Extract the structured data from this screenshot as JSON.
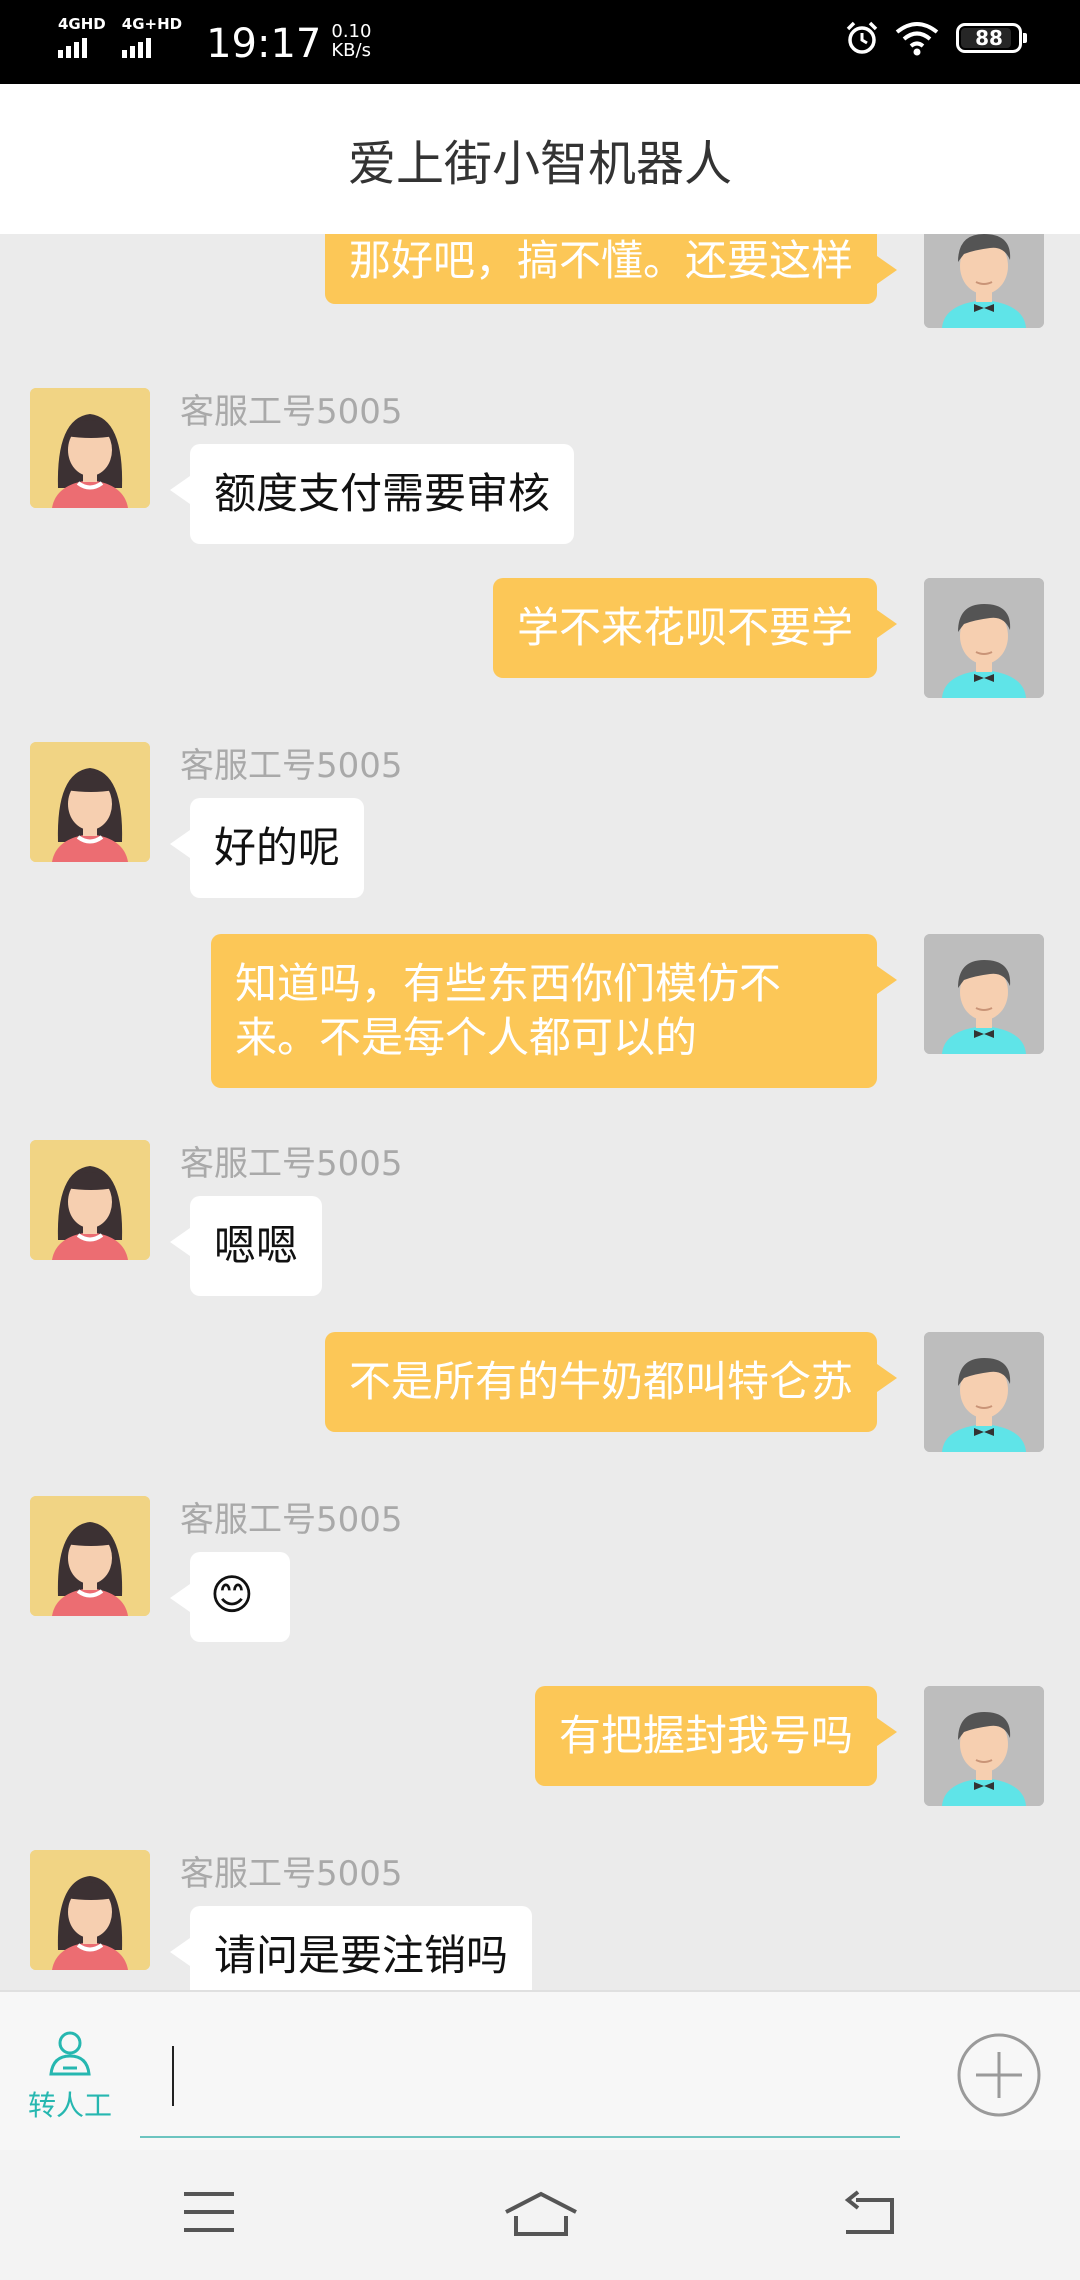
{
  "status": {
    "net1": "4GHD",
    "net2": "4G+HD",
    "time": "19:17",
    "speed_value": "0.10",
    "speed_unit": "KB/s",
    "battery": "88"
  },
  "header": {
    "title": "爱上街小智机器人"
  },
  "chat": {
    "agent_name": "客服工号5005",
    "messages": [
      {
        "from": "user",
        "text": "那好吧，搞不懂。还要这样"
      },
      {
        "from": "agent",
        "name": "客服工号5005",
        "text": "额度支付需要审核"
      },
      {
        "from": "user",
        "text": "学不来花呗不要学"
      },
      {
        "from": "agent",
        "name": "客服工号5005",
        "text": "好的呢"
      },
      {
        "from": "user",
        "text": "知道吗，有些东西你们模仿不来。不是每个人都可以的"
      },
      {
        "from": "agent",
        "name": "客服工号5005",
        "text": "嗯嗯"
      },
      {
        "from": "user",
        "text": "不是所有的牛奶都叫特仑苏"
      },
      {
        "from": "agent",
        "name": "客服工号5005",
        "text": "😊"
      },
      {
        "from": "user",
        "text": "有把握封我号吗"
      },
      {
        "from": "agent",
        "name": "客服工号5005",
        "text": "请问是要注销吗"
      }
    ]
  },
  "input": {
    "transfer_label": "转人工",
    "transfer_icon": "person-icon",
    "plus_icon": "plus-circle-icon"
  },
  "nav": {
    "menu_icon": "menu-icon",
    "home_icon": "home-icon",
    "back_icon": "back-icon"
  }
}
